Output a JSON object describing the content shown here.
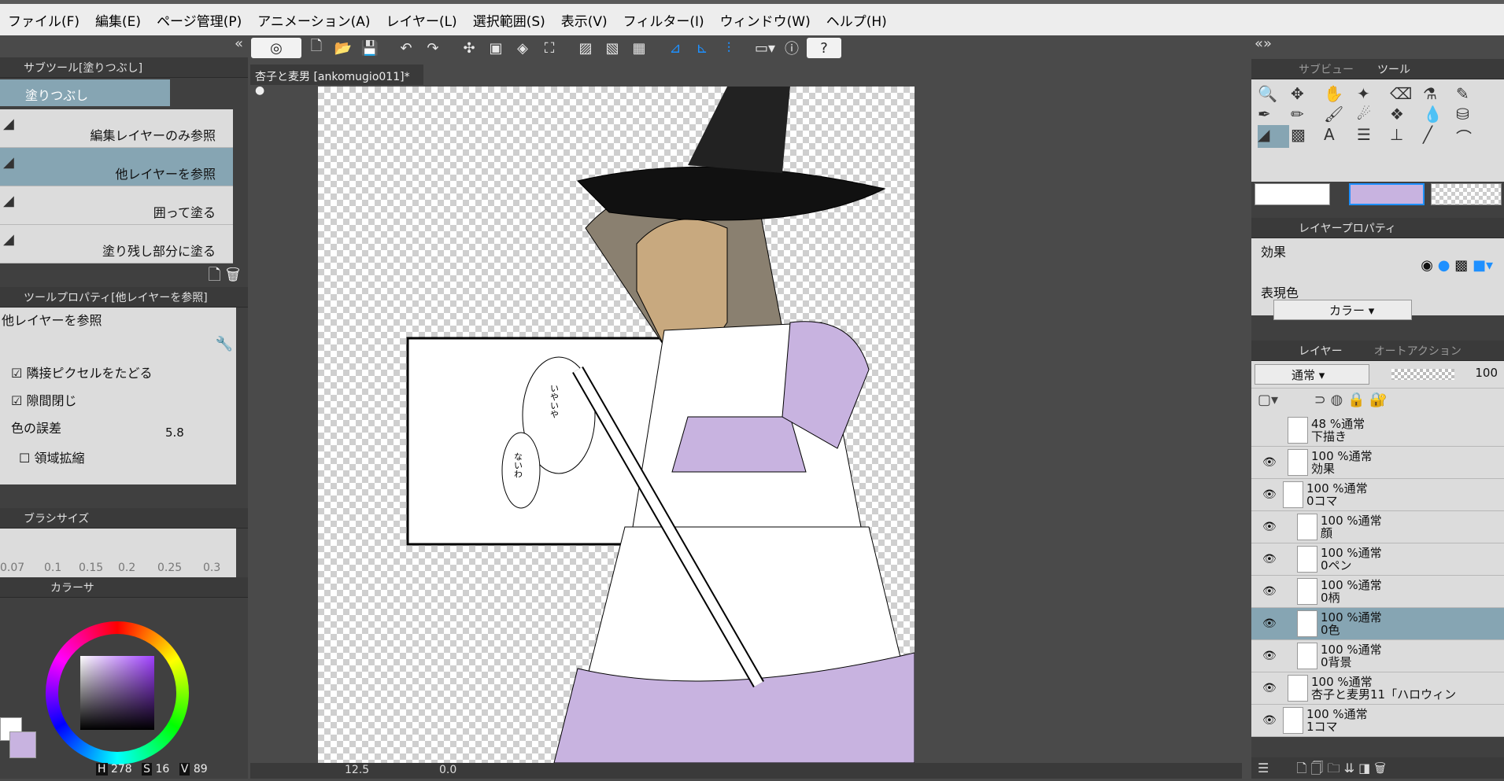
{
  "menu": [
    "ファイル(F)",
    "編集(E)",
    "ページ管理(P)",
    "アニメーション(A)",
    "レイヤー(L)",
    "選択範囲(S)",
    "表示(V)",
    "フィルター(I)",
    "ウィンドウ(W)",
    "ヘルプ(H)"
  ],
  "subtool": {
    "header": "サブツール[塗りつぶし]",
    "tab": "塗りつぶし",
    "items": [
      "編集レイヤーのみ参照",
      "他レイヤーを参照",
      "囲って塗る",
      "塗り残し部分に塗る"
    ],
    "selected_index": 1
  },
  "toolprop": {
    "header": "ツールプロパティ[他レイヤーを参照]",
    "title": "他レイヤーを参照",
    "adjacent": "隣接ピクセルをたどる",
    "gap": "隙間閉じ",
    "tolerance_label": "色の誤差",
    "tolerance_value": "5.8",
    "expand": "領域拡縮"
  },
  "brushsize": {
    "header": "ブラシサイズ",
    "values": [
      "0.07",
      "0.1",
      "0.15",
      "0.2",
      "0.25",
      "0.3"
    ]
  },
  "colorpanel": {
    "header": "カラーサ",
    "h_label": "H",
    "h": "278",
    "s_label": "S",
    "s": "16",
    "v_label": "V",
    "v": "89"
  },
  "document": {
    "tab": "杏子と麦男 [ankomugio011]*"
  },
  "status": {
    "zoom": "12.5",
    "angle": "0.0"
  },
  "right": {
    "subview_tab": "サブビュー",
    "tool_tab": "ツール",
    "layerprop_header": "レイヤープロパティ",
    "effect_label": "効果",
    "color_label": "表現色",
    "color_value": "カラー",
    "layer_tab": "レイヤー",
    "autoaction_tab": "オートアクション",
    "blend": "通常",
    "opacity": "100",
    "layers": [
      {
        "top": "48 %通常",
        "name": "下描き"
      },
      {
        "top": "100 %通常",
        "name": "効果"
      },
      {
        "top": "100 %通常",
        "name": "0コマ"
      },
      {
        "top": "100 %通常",
        "name": "顔"
      },
      {
        "top": "100 %通常",
        "name": "0ペン"
      },
      {
        "top": "100 %通常",
        "name": "0柄"
      },
      {
        "top": "100 %通常",
        "name": "0色"
      },
      {
        "top": "100 %通常",
        "name": "0背景"
      },
      {
        "top": "100 %通常",
        "name": "杏子と麦男11「ハロウィン"
      },
      {
        "top": "100 %通常",
        "name": "1コマ"
      }
    ],
    "selected_layer": 6
  },
  "art": {
    "balloon1": "いやいや",
    "balloon2": "ないわ"
  },
  "colors": {
    "accent_selected": "#86a5b3",
    "panel_light": "#dcdcdc",
    "panel_dark": "#404040",
    "lavender": "#c8b3e0"
  }
}
